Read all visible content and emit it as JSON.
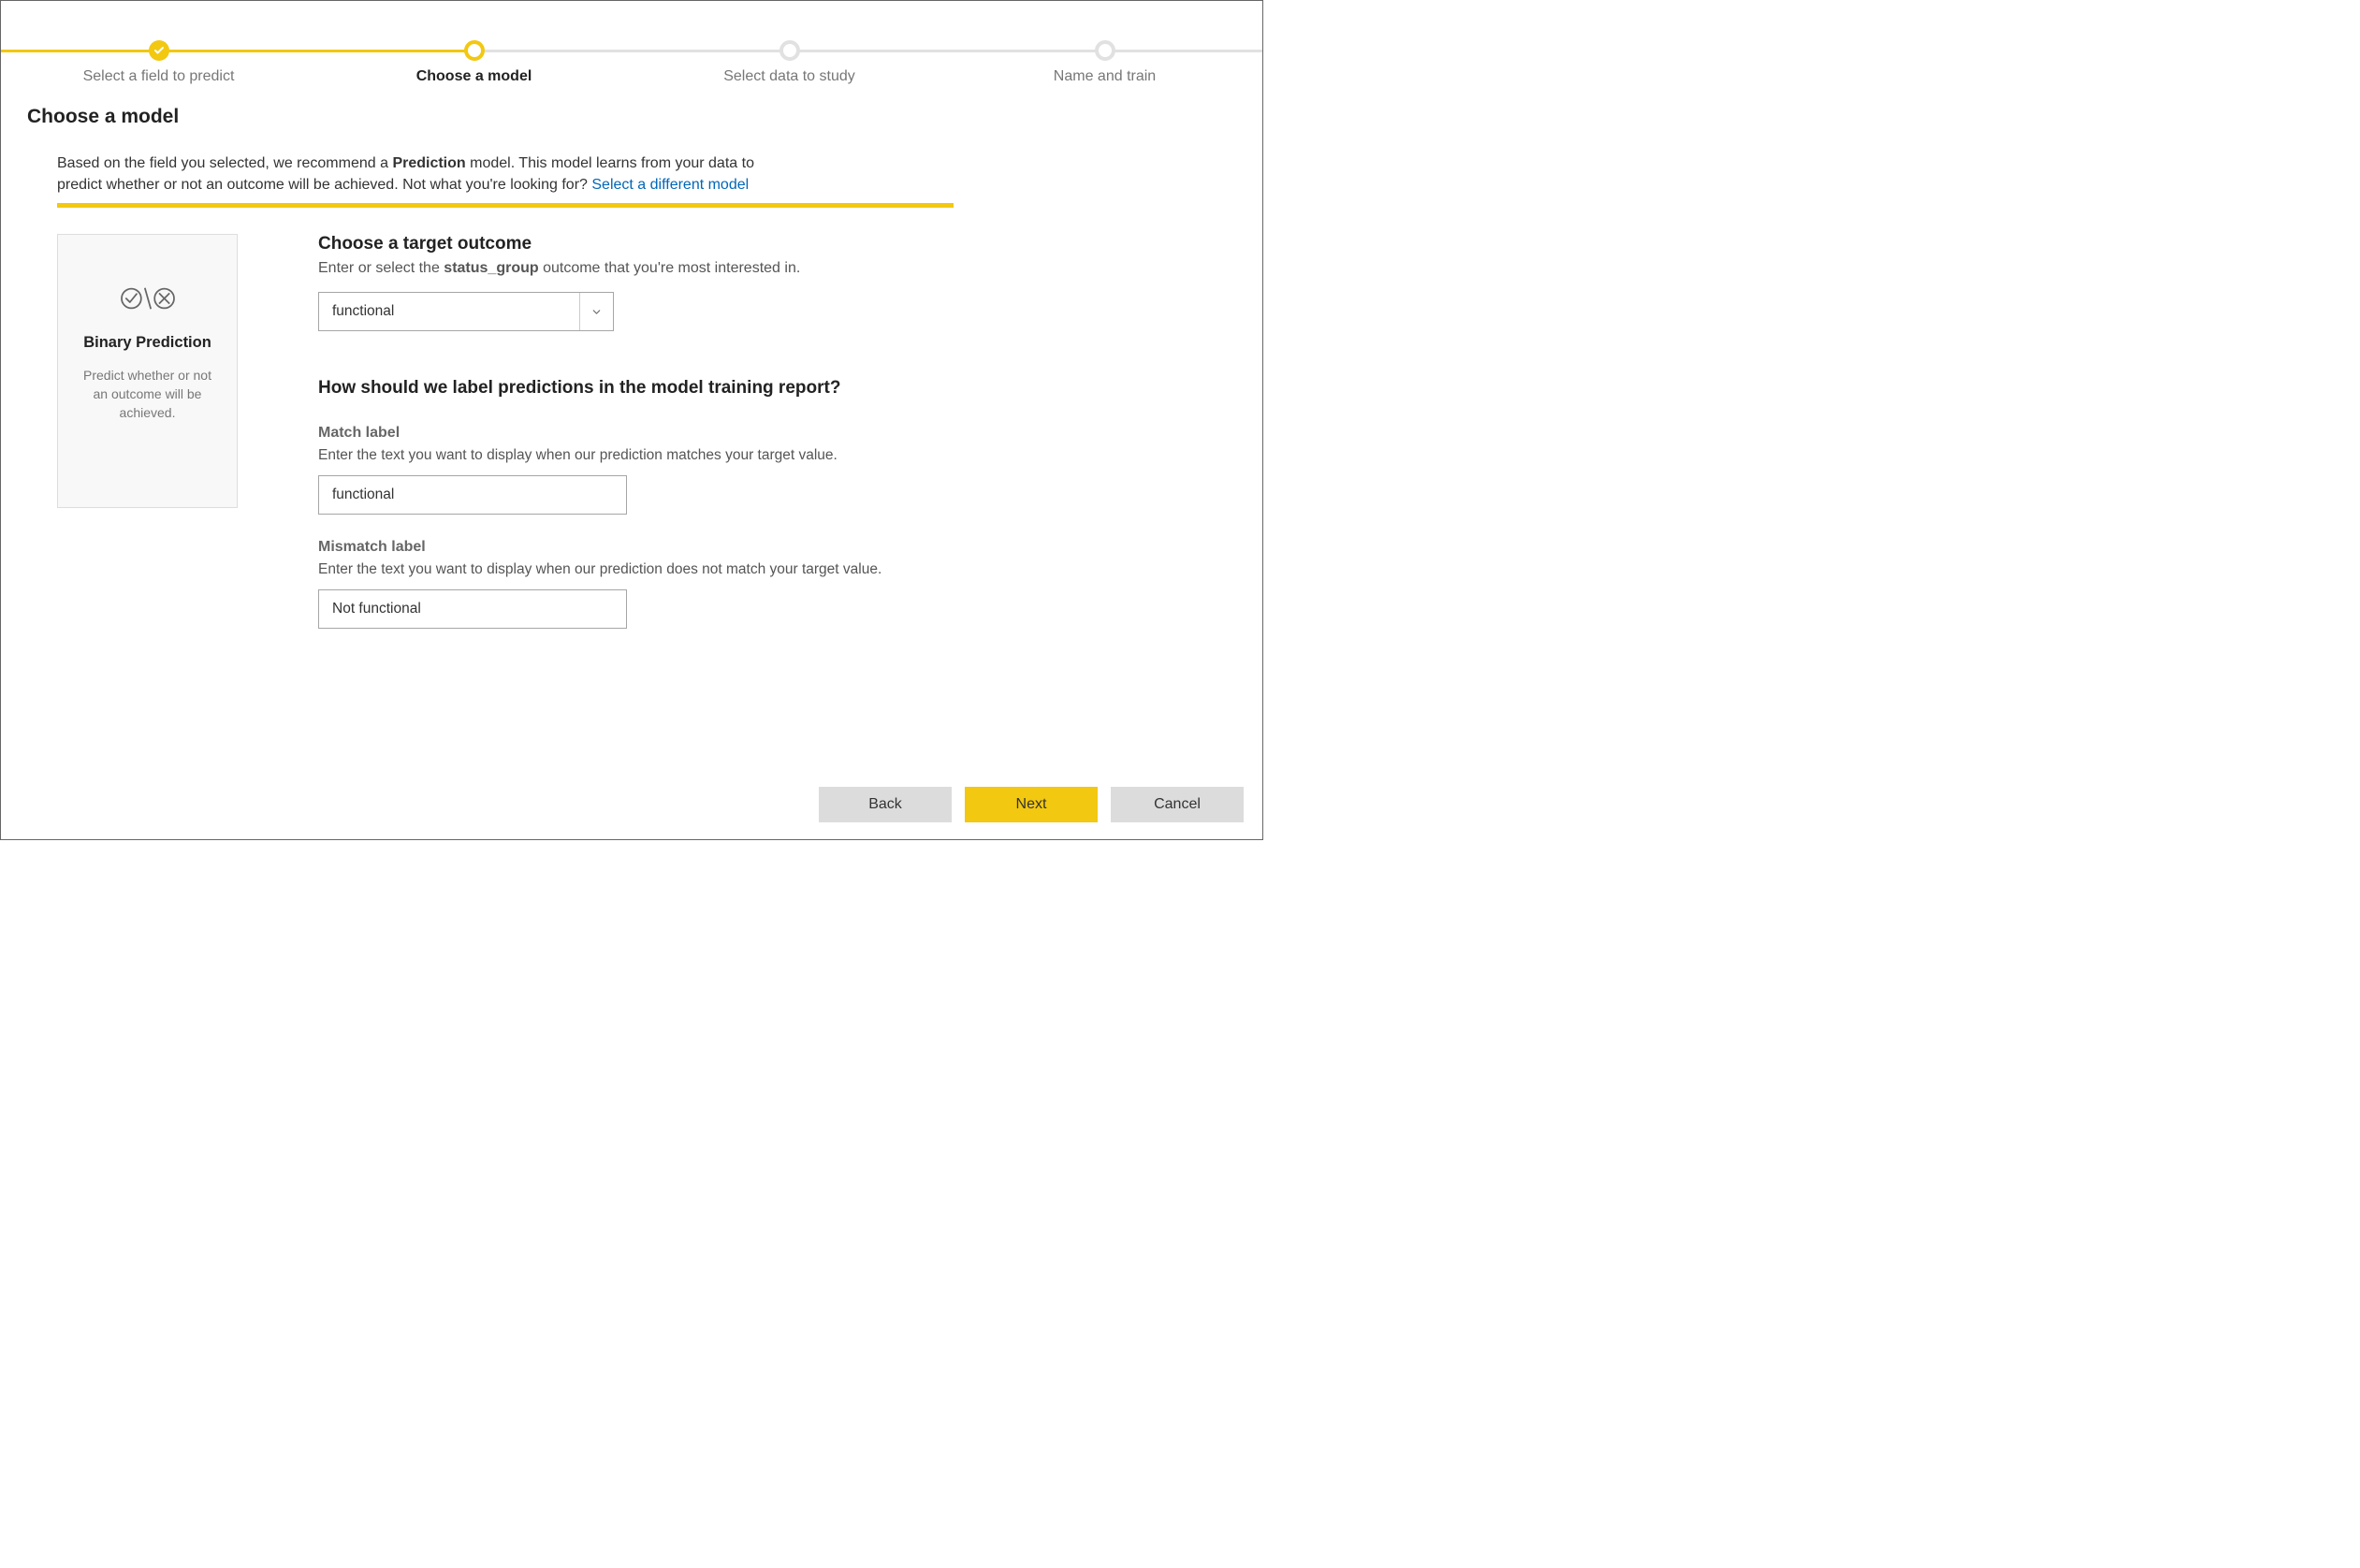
{
  "stepper": {
    "steps": [
      {
        "label": "Select a field to predict"
      },
      {
        "label": "Choose a model"
      },
      {
        "label": "Select data to study"
      },
      {
        "label": "Name and train"
      }
    ]
  },
  "page_title": "Choose a model",
  "description": {
    "pre": "Based on the field you selected, we recommend a ",
    "bold": "Prediction",
    "mid": " model. This model learns from your data to predict whether or not an outcome will be achieved. Not what you're looking for? ",
    "link": "Select a different model"
  },
  "card": {
    "title": "Binary Prediction",
    "desc": "Predict whether or not an outcome will be achieved."
  },
  "target": {
    "title": "Choose a target outcome",
    "sub_pre": "Enter or select the ",
    "sub_bold": "status_group",
    "sub_post": " outcome that you're most interested in.",
    "selected": "functional"
  },
  "labels_section": {
    "title": "How should we label predictions in the model training report?",
    "match": {
      "label": "Match label",
      "desc": "Enter the text you want to display when our prediction matches your target value.",
      "value": "functional"
    },
    "mismatch": {
      "label": "Mismatch label",
      "desc": "Enter the text you want to display when our prediction does not match your target value.",
      "value": "Not functional"
    }
  },
  "buttons": {
    "back": "Back",
    "next": "Next",
    "cancel": "Cancel"
  }
}
